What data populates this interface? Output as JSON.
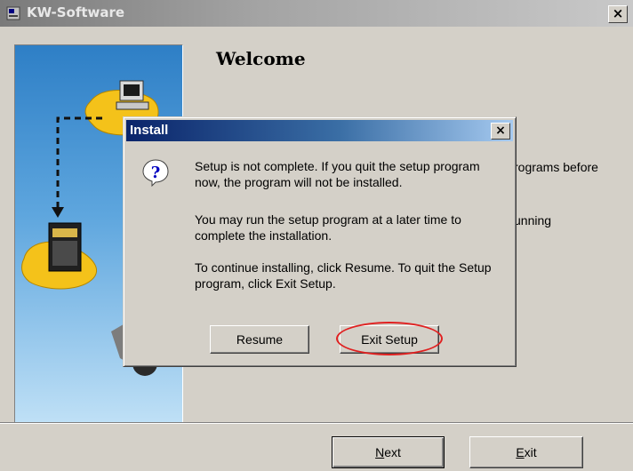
{
  "window": {
    "title": "KW-Software",
    "close_glyph": "×"
  },
  "welcome": {
    "heading": "Welcome",
    "fragment_1": "rograms before",
    "fragment_2": "unning"
  },
  "footer": {
    "next_label_accel": "N",
    "next_label_rest": "ext",
    "exit_label_accel": "E",
    "exit_label_rest": "xit"
  },
  "dialog": {
    "title": "Install",
    "close_glyph": "×",
    "icon": "question-icon",
    "message_1": "Setup is not complete.  If you quit the setup program now, the program will not be installed.",
    "message_2": "You may run the setup program at a later time to complete the installation.",
    "message_3": "To continue installing, click Resume.  To quit the Setup program, click Exit Setup.",
    "resume_label": "Resume",
    "exit_setup_label": "Exit Setup",
    "highlight_color": "#e02020"
  },
  "colors": {
    "dialog_title_start": "#0a246a",
    "dialog_title_end": "#a6caf0",
    "face": "#d4d0c8"
  }
}
